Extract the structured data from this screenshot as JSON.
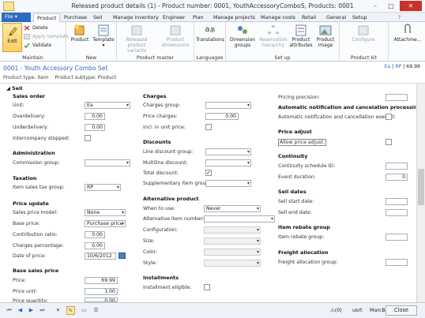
{
  "window": {
    "title": "Released product details (1) - Product number: 0001, YouthAccessoryComboS, Products: 0001",
    "min": "–",
    "max": "□",
    "close": "✕"
  },
  "tabs": [
    "File",
    "Product",
    "Purchase",
    "Sell",
    "Manage inventory",
    "Engineer",
    "Plan",
    "Manage projects",
    "Manage costs",
    "Retail",
    "General",
    "Setup"
  ],
  "ribbon": {
    "maintain": {
      "label": "Maintain",
      "edit": "Edit",
      "delete": "Delete",
      "apply_template": "Apply template",
      "validate": "Validate"
    },
    "new": {
      "label": "New",
      "product": "Product",
      "template": "Template"
    },
    "product_master": {
      "label": "Product master",
      "released_variants": "Released product variants",
      "dimensions": "Product dimensions"
    },
    "languages": {
      "label": "Languages",
      "translations": "Translations"
    },
    "setup": {
      "label": "Set up",
      "dimension_groups": "Dimension groups",
      "reservation_hierarchy": "Reservation hierarchy",
      "product_attributes": "Product attributes",
      "product_image": "Product image"
    },
    "product_kit": {
      "label": "Product kit",
      "configure": "Configure"
    },
    "attachments": "Attachme..."
  },
  "header": {
    "title": "0001 : Youth Accessory Combo Set",
    "product_type_label": "Product type:",
    "product_type": "Item",
    "product_subtype_label": "Product subtype:",
    "product_subtype": "Product",
    "links": [
      "Ea",
      "RP",
      "69.99"
    ]
  },
  "fasttab": {
    "label": "Sell"
  },
  "col1": {
    "sales_order": {
      "heading": "Sales order",
      "unit_label": "Unit:",
      "unit": "Ea",
      "overdelivery_label": "Overdelivery:",
      "overdelivery": "0.00",
      "underdelivery_label": "Underdelivery:",
      "underdelivery": "0.00",
      "intercompany_label": "Intercompany stopped:"
    },
    "administration": {
      "heading": "Administration",
      "commission_label": "Commission group:"
    },
    "taxation": {
      "heading": "Taxation",
      "item_tax_label": "Item sales tax group:",
      "item_tax": "RP"
    },
    "price_update": {
      "heading": "Price update",
      "model_label": "Sales price model:",
      "model": "None",
      "base_label": "Base price:",
      "base": "Purchase price",
      "contribution_label": "Contribution ratio:",
      "contribution": "0.00",
      "charges_pct_label": "Charges percentage:",
      "charges_pct": "0.00",
      "date_label": "Date of price:",
      "date": "10/6/2012"
    },
    "base_sales_price": {
      "heading": "Base sales price",
      "price_label": "Price:",
      "price": "69.99",
      "unit_label": "Price unit:",
      "unit": "1.00",
      "qty_label": "Price quantity:",
      "qty": "0.00"
    }
  },
  "col2": {
    "charges": {
      "heading": "Charges",
      "group_label": "Charges group:",
      "price_charges_label": "Price charges:",
      "price_charges": "0.00",
      "incl_label": "Incl. in unit price:"
    },
    "discounts": {
      "heading": "Discounts",
      "line_label": "Line discount group:",
      "multiline_label": "Multiline discount:",
      "total_label": "Total discount:",
      "supp_label": "Supplementary item group:"
    },
    "alternative": {
      "heading": "Alternative product",
      "when_label": "When to use:",
      "when": "Never",
      "alt_label": "Alternative item number:",
      "config_label": "Configuration:",
      "size_label": "Size:",
      "color_label": "Color:",
      "style_label": "Style:"
    },
    "installments": {
      "heading": "Installments",
      "eligible_label": "Installment eligible:"
    }
  },
  "col3": {
    "pricing_precision_label": "Pricing precision:",
    "auto_notif": {
      "heading": "Automatic notification and cancelation processing",
      "exempt_label": "Automatic notification and cancellation exempt:"
    },
    "price_adjust": {
      "heading": "Price adjust",
      "allow_label": "Allow price adjust:"
    },
    "continuity": {
      "heading": "Continuity",
      "schedule_label": "Continuity schedule ID:",
      "duration_label": "Event duration:",
      "duration": "0"
    },
    "sell_dates": {
      "heading": "Sell dates",
      "start_label": "Sell start date:",
      "end_label": "Sell end date:"
    },
    "rebate": {
      "heading": "Item rebate group",
      "group_label": "Item rebate group:"
    },
    "freight": {
      "heading": "Freight allocation",
      "group_label": "Freight allocation group:"
    }
  },
  "status": {
    "badge": "(0)",
    "user": "usrt",
    "company": "MarcB",
    "close": "Close"
  }
}
